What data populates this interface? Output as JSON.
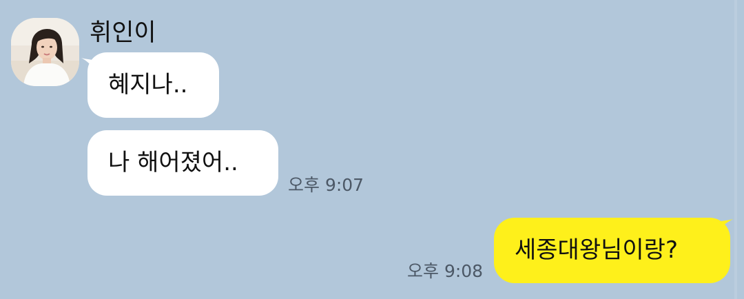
{
  "conversation": {
    "sender_name": "휘인이",
    "incoming": [
      {
        "text": "혜지나.."
      },
      {
        "text": "나 해어졌어.."
      }
    ],
    "incoming_time": "오후 9:07",
    "outgoing": [
      {
        "text": "세종대왕님이랑?"
      }
    ],
    "outgoing_time": "오후 9:08"
  },
  "colors": {
    "background": "#b2c7da",
    "incoming_bubble": "#ffffff",
    "outgoing_bubble": "#fef01b",
    "timestamp": "#4c5866"
  },
  "icons": {
    "avatar": "profile-photo-avatar"
  }
}
